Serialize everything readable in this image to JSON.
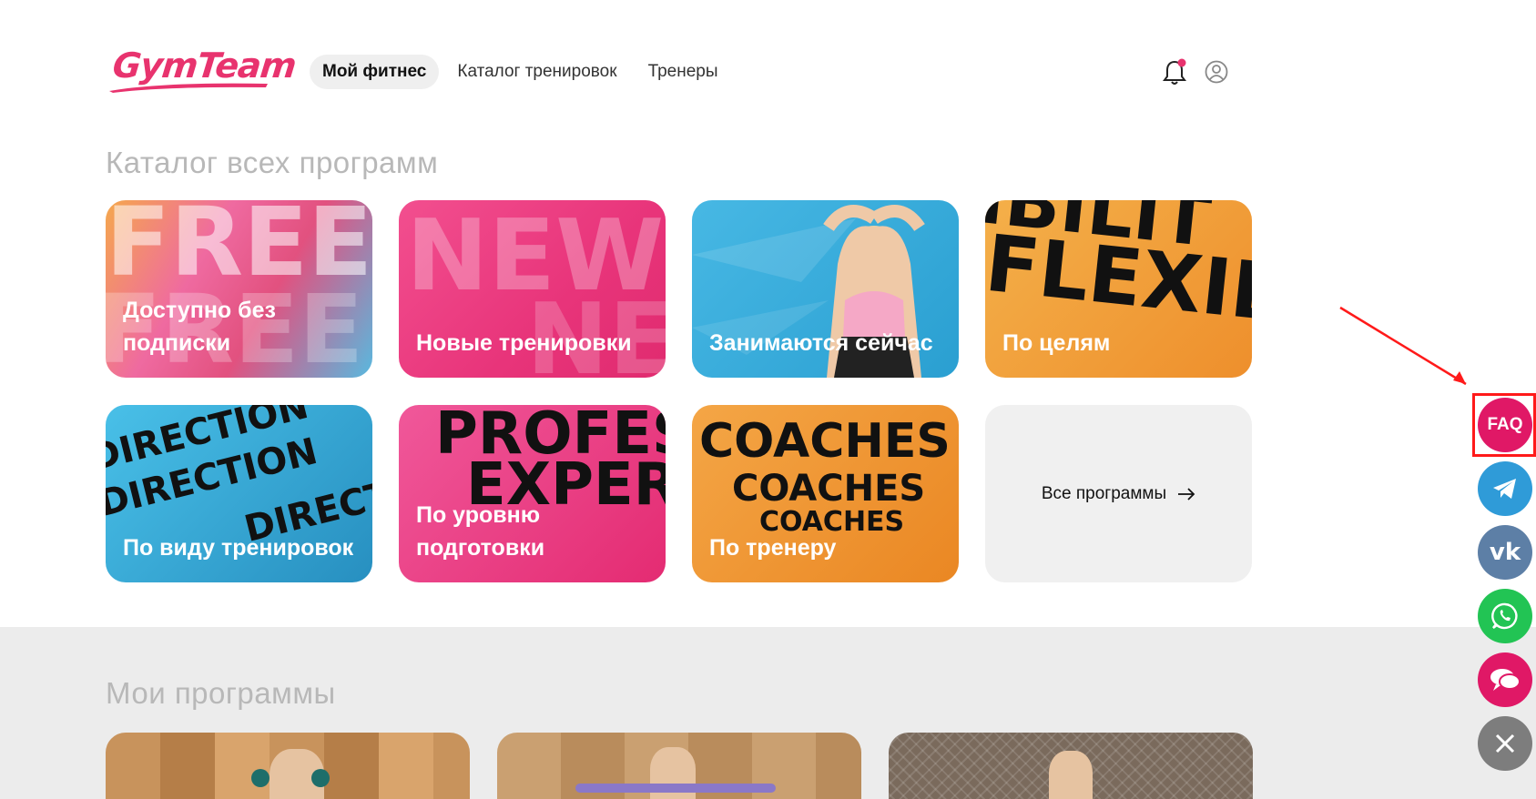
{
  "header": {
    "logo_text": "GymTeam",
    "nav": [
      {
        "label": "Мой фитнес",
        "active": true
      },
      {
        "label": "Каталог тренировок",
        "active": false
      },
      {
        "label": "Тренеры",
        "active": false
      }
    ],
    "icons": [
      "bell-icon",
      "user-icon"
    ]
  },
  "catalog": {
    "title": "Каталог всех программ",
    "tiles": [
      {
        "label": "Доступно без подписки",
        "bg_text": "FREE"
      },
      {
        "label": "Новые тренировки",
        "bg_text": "NEW"
      },
      {
        "label": "Занимаются сейчас"
      },
      {
        "label": "По целям",
        "bg_text": "FLEXIB"
      },
      {
        "label": "По виду тренировок",
        "bg_text": "DIRECTION"
      },
      {
        "label": "По уровню подготовки",
        "bg_text": "PROFES EXPER"
      },
      {
        "label": "По тренеру",
        "bg_text": "COACHES"
      },
      {
        "label": "Все программы"
      }
    ]
  },
  "my_programs": {
    "title": "Мои программы"
  },
  "floating": {
    "faq_label": "FAQ",
    "buttons": [
      "telegram-icon",
      "vk-icon",
      "whatsapp-icon",
      "chat-icon",
      "close-icon"
    ]
  },
  "colors": {
    "brand": "#e8336e",
    "faq": "#e01866",
    "telegram": "#2f9bd8",
    "vk": "#5d7fa6",
    "whatsapp": "#22c454",
    "close": "#7d7d7d",
    "annotation": "#ff1a1a"
  }
}
